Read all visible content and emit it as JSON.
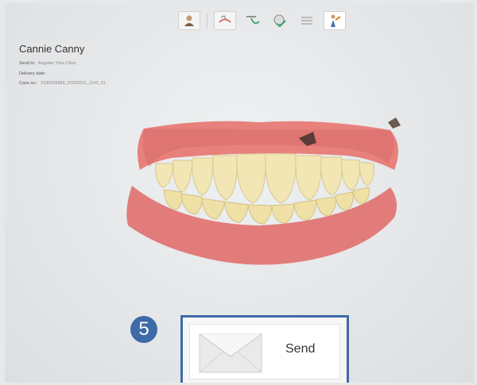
{
  "toolbar": {
    "tools": [
      {
        "name": "patient-icon"
      },
      {
        "name": "scan-icon"
      },
      {
        "name": "trim-icon"
      },
      {
        "name": "analysis-icon"
      },
      {
        "name": "layers-icon"
      },
      {
        "name": "send-step-icon"
      }
    ]
  },
  "case": {
    "patient_name": "Cannie Canny",
    "send_to_label": "Send to:",
    "send_to_value": "Angeles Trios Clinic",
    "delivery_label": "Delivery date:",
    "delivery_value": "",
    "case_no_label": "Case no.:",
    "case_no_value": "1035939989_20220211_1142_01"
  },
  "send_button": {
    "label": "Send",
    "icon": "envelope-icon"
  },
  "step_badge": {
    "number": "5"
  },
  "colors": {
    "accent": "#3e6aa8",
    "gum": "#e07a78",
    "tooth": "#f2e6b5"
  }
}
